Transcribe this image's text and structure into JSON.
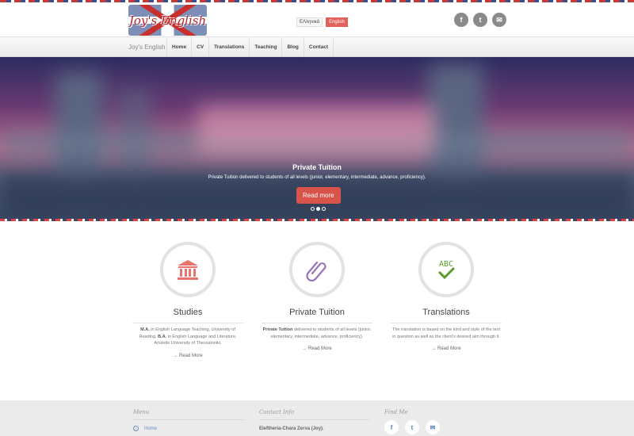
{
  "header": {
    "logo_text": "Joy's English",
    "languages": [
      "ΕΛληνικά",
      "English"
    ],
    "active_language": "English",
    "social": [
      {
        "name": "facebook-icon",
        "glyph": "f"
      },
      {
        "name": "twitter-icon",
        "glyph": "t"
      },
      {
        "name": "email-icon",
        "glyph": "✉"
      }
    ]
  },
  "nav": {
    "brand": "Joy's English",
    "items": [
      "Home",
      "CV",
      "Translations",
      "Teaching",
      "Blog",
      "Contact"
    ]
  },
  "hero": {
    "title": "Private Tuition",
    "subtitle": "Private Tuition delivered to students of all levels (junior, elementary, intermediate, advance, proficiency).",
    "button": "Read more",
    "slides": 3,
    "active_slide": 2
  },
  "features": [
    {
      "title": "Studies",
      "icon": "building-icon",
      "text_b1": "M.A.",
      "text_1": " in English Language Teaching, University of Reading. ",
      "text_b2": "B.A.",
      "text_2": " in English Language and Literature, Aristotle University of Thessaloniki.",
      "more": "→ Read More"
    },
    {
      "title": "Private Tuition",
      "icon": "paperclip-icon",
      "text_b1": "Private Tuition",
      "text_1": " delivered to students of all levels (junior, elementary, intermediate, advance, proficiency).",
      "more": "→ Read More"
    },
    {
      "title": "Translations",
      "icon": "abc-check-icon",
      "icon_text": "ABC",
      "text_1": "The translation is based on the kind and style of the text in question as well as the client's desired aim through it.",
      "more": "→ Read More"
    }
  ],
  "footer": {
    "menu_title": "Menu",
    "menu_first": "Home",
    "contact_title": "Contact Info",
    "contact_name": "Eleftheria-Chara Zerva (Joy).",
    "find_title": "Find Me",
    "social": [
      "f",
      "t",
      "✉"
    ]
  },
  "colors": {
    "accent_red": "#d8534a",
    "brand_red": "#e8736c",
    "clip_purple": "#9b73b8",
    "check_green": "#5a9a2a"
  }
}
